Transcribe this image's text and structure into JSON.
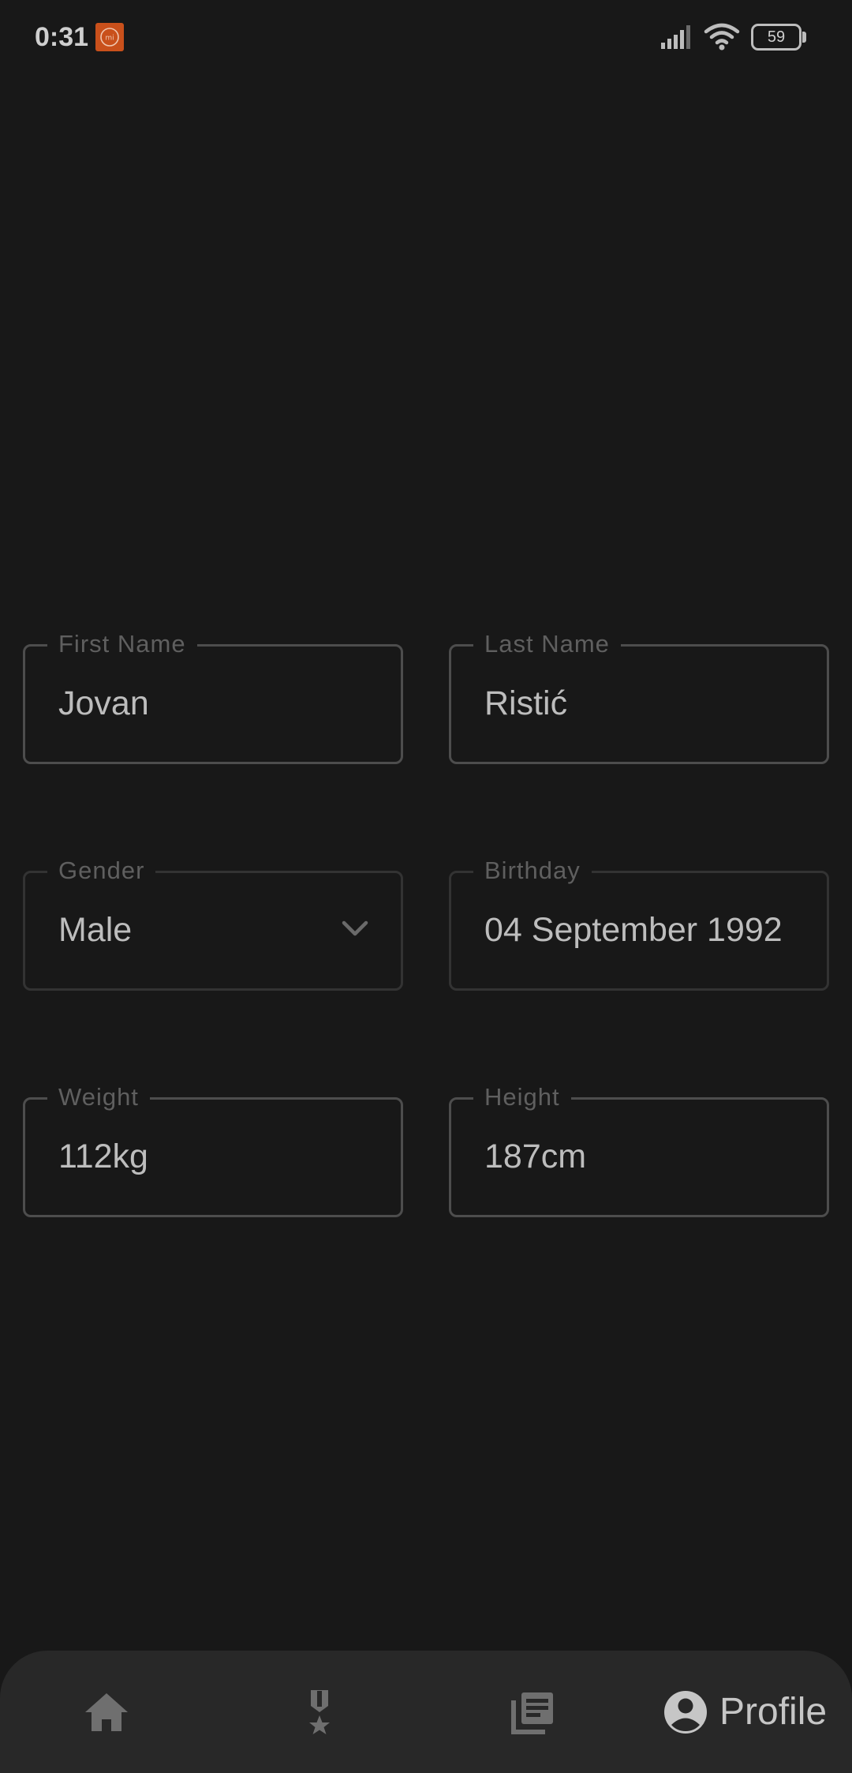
{
  "status_bar": {
    "time": "0:31",
    "battery_level": "59",
    "notification_icon": "mi-app-icon",
    "icons": [
      "signal-icon",
      "wifi-icon",
      "battery-icon"
    ]
  },
  "form": {
    "first_name": {
      "label": "First Name",
      "value": "Jovan"
    },
    "last_name": {
      "label": "Last Name",
      "value": "Ristić"
    },
    "gender": {
      "label": "Gender",
      "value": "Male"
    },
    "birthday": {
      "label": "Birthday",
      "value": "04 September 1992"
    },
    "weight": {
      "label": "Weight",
      "value": "112kg"
    },
    "height": {
      "label": "Height",
      "value": "187cm"
    }
  },
  "bottom_nav": {
    "items": [
      {
        "icon": "home-icon",
        "label": ""
      },
      {
        "icon": "medal-icon",
        "label": ""
      },
      {
        "icon": "news-icon",
        "label": ""
      },
      {
        "icon": "account-circle-icon",
        "label": "Profile",
        "active": true
      }
    ]
  },
  "colors": {
    "background": "#181818",
    "field_border": "#4d4d4d",
    "label": "#5f5f5f",
    "value": "#bdbdbd",
    "nav_background": "#282828",
    "mi_badge": "#c9501b"
  }
}
